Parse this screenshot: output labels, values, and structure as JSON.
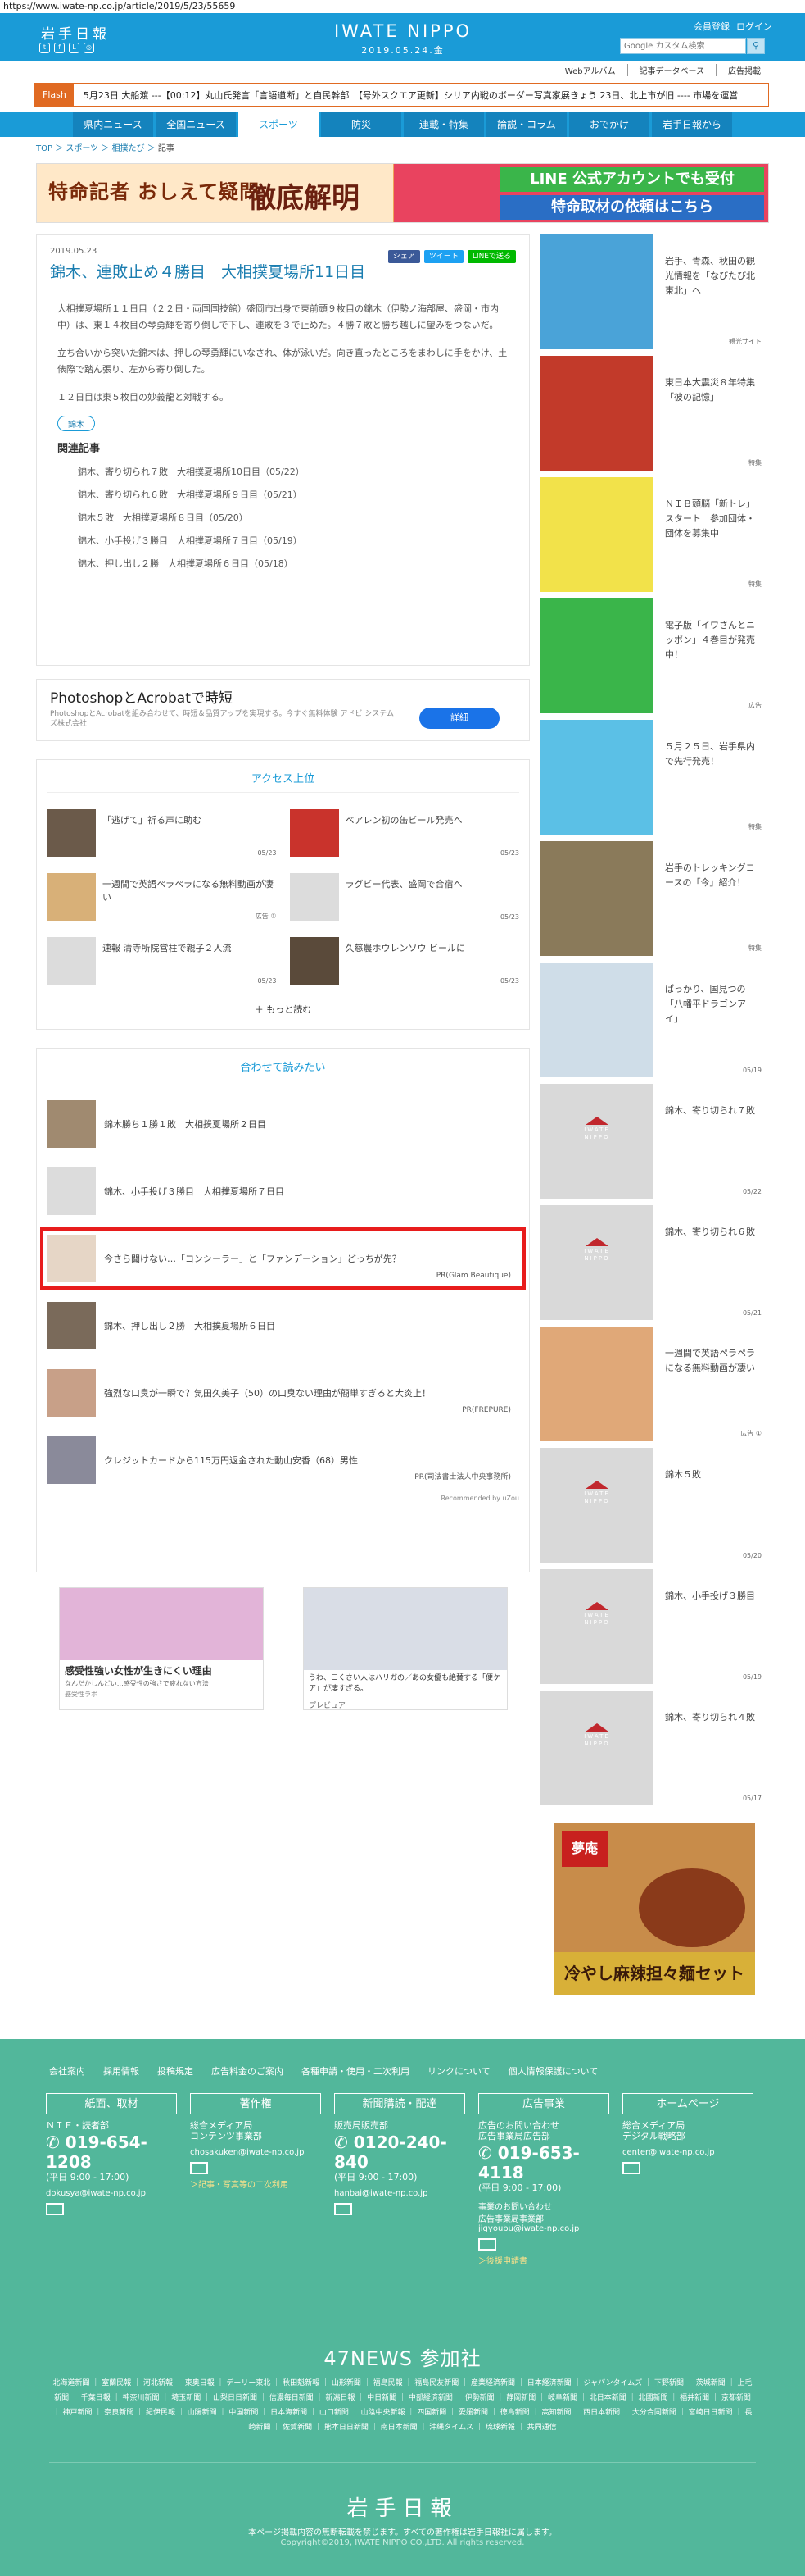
{
  "url": "https://www.iwate-np.co.jp/article/2019/5/23/55659",
  "header": {
    "logo": "岩手日報",
    "brand": "IWATE NIPPO",
    "date": "2019.05.24.金",
    "links": [
      "会員登録",
      "ログイン"
    ],
    "search_placeholder": "Google カスタム検索",
    "sublinks": [
      "Webアルバム",
      "記事データベース",
      "広告掲載"
    ],
    "social_icons": [
      "twitter-icon",
      "facebook-icon",
      "line-icon",
      "instagram-icon"
    ]
  },
  "flash": {
    "tag": "Flash",
    "text": "5月23日 大船渡 ---【00:12】丸山氏発言「言語道断」と自民幹部　【号外スクエア更新】シリア内戦のボーダー写真家展きょう 23日、北上市が旧 ---- 市場を運営"
  },
  "nav": [
    "県内ニュース",
    "全国ニュース",
    "スポーツ",
    "防災",
    "連載・特集",
    "論説・コラム",
    "おでかけ",
    "岩手日報から"
  ],
  "nav_active": 2,
  "breadcrumb": [
    "TOP",
    "スポーツ",
    "相撲たび",
    "記事"
  ],
  "banner": {
    "left_text": "特命記者 おしえて疑問",
    "left_big": "徹底解明",
    "right_a": "LINE 公式アカウントでも受付",
    "right_b": "特命取材の依頼はこちら"
  },
  "article": {
    "date": "2019.05.23",
    "share": [
      "シェア",
      "ツイート",
      "LINEで送る"
    ],
    "title": "錦木、連敗止め４勝目　大相撲夏場所11日目",
    "paragraphs": [
      "大相撲夏場所１１日目（２２日・両国国技館）盛岡市出身で東前頭９枚目の錦木（伊勢ノ海部屋、盛岡・市内中）は、東１４枚目の琴勇輝を寄り倒しで下し、連敗を３で止めた。４勝７敗と勝ち越しに望みをつないだ。",
      "立ち合いから突いた錦木は、押しの琴勇輝にいなされ、体が泳いだ。向き直ったところをまわしに手をかけ、土俵際で踏ん張り、左から寄り倒した。",
      "１２日目は東５枚目の妙義龍と対戦する。"
    ],
    "keyword": "錦木",
    "related_title": "関連記事",
    "related": [
      "錦木、寄り切られ７敗　大相撲夏場所10日目（05/22）",
      "錦木、寄り切られ６敗　大相撲夏場所９日目（05/21）",
      "錦木５敗　大相撲夏場所８日目（05/20）",
      "錦木、小手投げ３勝目　大相撲夏場所７日目（05/19）",
      "錦木、押し出し２勝　大相撲夏場所６日目（05/18）"
    ]
  },
  "ad1": {
    "title": "PhotoshopとAcrobatで時短",
    "desc": "PhotoshopとAcrobatを組み合わせて、時短＆品質アップを実現する。今すぐ無料体験 アドビ システムズ株式会社",
    "button": "詳細"
  },
  "ranking": {
    "title": "アクセス上位",
    "items": [
      {
        "text": "「逃げて」祈る声に助む",
        "date": "05/23"
      },
      {
        "text": "ベアレン初の缶ビール発売へ",
        "date": "05/23"
      },
      {
        "text": "一週間で英語ペラペラになる無料動画が凄い",
        "date": "広告 ①"
      },
      {
        "text": "ラグビー代表、盛岡で合宿へ",
        "date": "05/23"
      },
      {
        "text": "速報 清寺所院営柱で親子２人流",
        "date": "05/23"
      },
      {
        "text": "久慈農ホウレンソウ ビールに",
        "date": "05/23"
      }
    ],
    "more": "もっと読む"
  },
  "yomi": {
    "title": "合わせて読みたい",
    "items": [
      {
        "text": "錦木勝ち１勝１敗　大相撲夏場所２日目",
        "pr": ""
      },
      {
        "text": "錦木、小手投げ３勝目　大相撲夏場所７日目",
        "pr": ""
      },
      {
        "text": "今さら聞けない…「コンシーラー」と「ファンデーション」どっちが先？",
        "pr": "PR(Glam Beautique)"
      },
      {
        "text": "錦木、押し出し２勝　大相撲夏場所６日目",
        "pr": ""
      },
      {
        "text": "強烈な口臭が一瞬で？気田久美子（50）の口臭ない理由が簡単すぎると大炎上！",
        "pr": "PR(FREPURE)"
      },
      {
        "text": "クレジットカードから115万円返金された動山安香（68）男性",
        "pr": "PR(司法書士法人中央事務所)"
      }
    ],
    "recommended": "Recommended by uZou"
  },
  "ads2": [
    {
      "title": "感受性強い女性が生きにくい理由",
      "sub": "なんだかしんどい…感受性の強さで疲れない方法",
      "src": "感受性ラボ"
    },
    {
      "title": "うわ、口くさい人はハリガの／あの女優も絶賛する「便ケア」が凄すぎる。",
      "sub": "",
      "src": "プレビュア"
    }
  ],
  "sidebar": [
    {
      "text": "岩手、青森、秋田の観光情報を「なびたび北東北」へ",
      "cat": "観光サイト",
      "img": "map"
    },
    {
      "text": "東日本大震災８年特集「彼の記憶」",
      "cat": "特集",
      "img": "quake"
    },
    {
      "text": "ＮＩＢ頭脳「新トレ」スタート　参加団体・団体を募集中",
      "cat": "特集",
      "img": "book"
    },
    {
      "text": "電子版「イワさんとニッポン」４巻目が発売中！",
      "cat": "広告",
      "img": "comic"
    },
    {
      "text": "５月２５日、岩手県内で先行発売！",
      "cat": "特集",
      "img": "whale"
    },
    {
      "text": "岩手のトレッキングコースの「今」紹介！",
      "cat": "特集",
      "img": "forest"
    },
    {
      "text": "ぱっかり、国見つの「八幡平ドラゴンアイ」",
      "cat": "05/19",
      "img": "snow"
    },
    {
      "text": "錦木、寄り切られ７敗",
      "cat": "05/22",
      "img": "ph"
    },
    {
      "text": "錦木、寄り切られ６敗",
      "cat": "05/21",
      "img": "ph"
    },
    {
      "text": "一週間で英語ペラペラになる無料動画が凄い",
      "cat": "広告 ①",
      "img": "girl"
    },
    {
      "text": "錦木５敗",
      "cat": "05/20",
      "img": "ph"
    },
    {
      "text": "錦木、小手投げ３勝目",
      "cat": "05/19",
      "img": "ph"
    },
    {
      "text": "錦木、寄り切られ４敗",
      "cat": "05/17",
      "img": "ph"
    }
  ],
  "foodad": {
    "brand": "夢庵",
    "title": "冷やし麻辣担々麺セット"
  },
  "footer": {
    "links": [
      "会社案内",
      "採用情報",
      "投稿規定",
      "広告料金のご案内",
      "各種申請・使用・二次利用",
      "リンクについて",
      "個人情報保護について"
    ],
    "cols": [
      {
        "h": "紙面、取材",
        "s": "ＮＩＥ・読者部",
        "ph": "019-654-1208",
        "hrs": "(平日 9:00 - 17:00)",
        "mail": "dokusya@iwate-np.co.jp",
        "y": ""
      },
      {
        "h": "著作権",
        "s": "総合メディア局\nコンテンツ事業部",
        "ph": "",
        "hrs": "",
        "mail": "chosakuken@iwate-np.co.jp",
        "y": "＞記事・写真等の二次利用"
      },
      {
        "h": "新聞購読・配達",
        "s": "販売局販売部",
        "ph": "0120-240-840",
        "hrs": "(平日 9:00 - 17:00)",
        "mail": "hanbai@iwate-np.co.jp",
        "y": ""
      },
      {
        "h": "広告事業",
        "s": "広告のお問い合わせ\n広告事業局広告部",
        "ph": "019-653-4118",
        "hrs": "(平日 9:00 - 17:00)",
        "mail": "事業のお問い合わせ\n広告事業局事業部\njigyoubu@iwate-np.co.jp",
        "y": "＞後援申請書"
      },
      {
        "h": "ホームページ",
        "s": "総合メディア局\nデジタル戦略部",
        "ph": "",
        "hrs": "",
        "mail": "center@iwate-np.co.jp",
        "y": ""
      }
    ],
    "n47": "47NEWS 参加社",
    "papers": "北海道新聞 ｜ 室蘭民報 ｜ 河北新報 ｜ 東奥日報 ｜ デーリー東北 ｜ 秋田魁新報 ｜ 山形新聞 ｜ 福島民報 ｜ 福島民友新聞 ｜ 産業経済新聞 ｜ 日本経済新聞 ｜ ジャパンタイムズ ｜ 下野新聞 ｜ 茨城新聞 ｜ 上毛新聞 ｜ 千葉日報 ｜ 神奈川新聞 ｜ 埼玉新聞 ｜ 山梨日日新聞 ｜ 信濃毎日新聞 ｜ 新潟日報 ｜ 中日新聞 ｜ 中部経済新聞 ｜ 伊勢新聞 ｜ 静岡新聞 ｜ 岐阜新聞 ｜ 北日本新聞 ｜ 北國新聞 ｜ 福井新聞 ｜ 京都新聞 ｜ 神戸新聞 ｜ 奈良新聞 ｜ 紀伊民報 ｜ 山陽新聞 ｜ 中国新聞 ｜ 日本海新聞 ｜ 山口新聞 ｜ 山陰中央新報 ｜ 四国新聞 ｜ 愛媛新聞 ｜ 徳島新聞 ｜ 高知新聞 ｜ 西日本新聞 ｜ 大分合同新聞 ｜ 宮崎日日新聞 ｜ 長崎新聞 ｜ 佐賀新聞 ｜ 熊本日日新聞 ｜ 南日本新聞 ｜ 沖縄タイムス ｜ 琉球新報 ｜ 共同通信",
    "logo": "岩手日報",
    "note": "本ページ掲載内容の無断転載を禁じます。すべての著作権は岩手日報社に属します。",
    "copy": "Copyright©2019, IWATE NIPPO CO.,LTD. All rights reserved."
  }
}
